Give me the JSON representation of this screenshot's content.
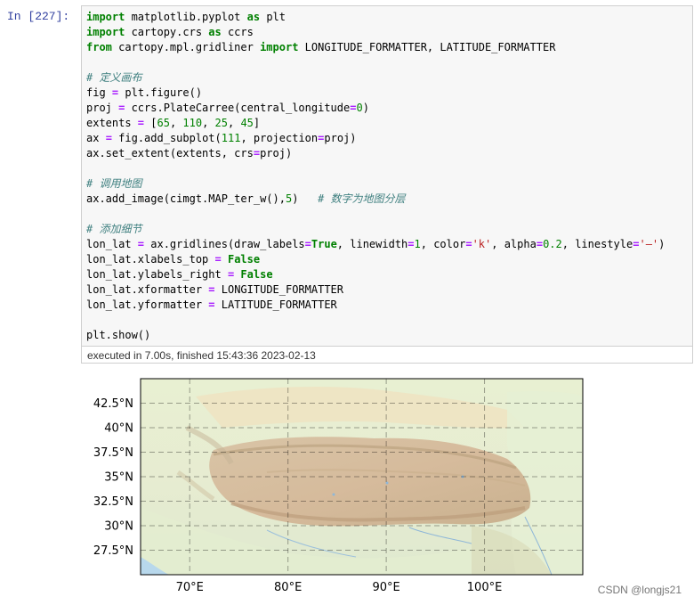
{
  "cell": {
    "prompt": "In  [227]:",
    "exec_info": "executed in 7.00s, finished 15:43:36 2023-02-13"
  },
  "plot": {
    "y_ticks": [
      "42.5°N",
      "40°N",
      "37.5°N",
      "35°N",
      "32.5°N",
      "30°N",
      "27.5°N"
    ],
    "x_ticks": [
      "70°E",
      "80°E",
      "90°E",
      "100°E"
    ]
  },
  "watermark": "CSDN @longjs21",
  "chart_data": {
    "type": "map",
    "projection": "PlateCarree",
    "central_longitude": 0,
    "extent": [
      65,
      110,
      25,
      45
    ],
    "x_ticks": [
      70,
      80,
      90,
      100
    ],
    "y_ticks": [
      27.5,
      30,
      32.5,
      35,
      37.5,
      40,
      42.5
    ],
    "gridlines": true,
    "gridline_style": "dashed",
    "gridline_color": "#000000",
    "gridline_alpha": 0.2
  }
}
